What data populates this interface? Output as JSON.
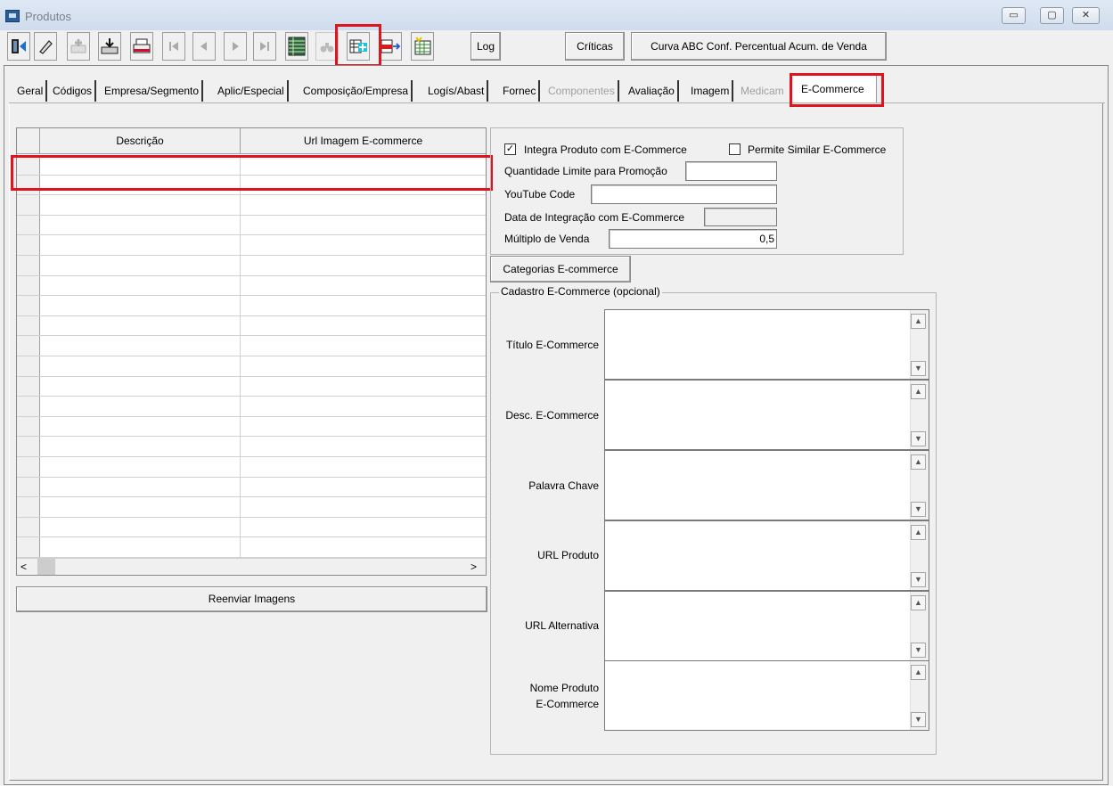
{
  "window": {
    "title": "Produtos"
  },
  "toolbar": {
    "log": "Log",
    "criticas": "Críticas",
    "curva": "Curva ABC Conf. Percentual Acum. de Venda"
  },
  "tabs": [
    {
      "label": "Geral",
      "enabled": true
    },
    {
      "label": "Códigos",
      "enabled": true
    },
    {
      "label": "Empresa/Segmento",
      "enabled": true
    },
    {
      "label": "Aplic/Especial",
      "enabled": true
    },
    {
      "label": "Composição/Empresa",
      "enabled": true
    },
    {
      "label": "Logís/Abast",
      "enabled": true
    },
    {
      "label": "Fornec",
      "enabled": true
    },
    {
      "label": "Componentes",
      "enabled": false
    },
    {
      "label": "Avaliação",
      "enabled": true
    },
    {
      "label": "Imagem",
      "enabled": true
    },
    {
      "label": "Medicam",
      "enabled": false
    },
    {
      "label": "E-Commerce",
      "enabled": true,
      "active": true
    }
  ],
  "grid": {
    "columns": [
      "Descrição",
      "Url Imagem E-commerce"
    ],
    "button": "Reenviar Imagens"
  },
  "options": {
    "integra_label": "Integra Produto com E-Commerce",
    "integra_checked": "✓",
    "similar_label": "Permite Similar E-Commerce",
    "qtd_limite_label": "Quantidade Limite para Promoção",
    "qtd_limite_value": "",
    "youtube_label": "YouTube Code",
    "youtube_value": "",
    "data_integracao_label": "Data de Integração com E-Commerce",
    "data_integracao_value": "",
    "multiplo_label": "Múltiplo de Venda",
    "multiplo_value": "0,5"
  },
  "categorias_button": "Categorias E-commerce",
  "cadastro": {
    "legend": "Cadastro E-Commerce (opcional)",
    "fields": [
      {
        "label": "Título E-Commerce"
      },
      {
        "label": "Desc. E-Commerce"
      },
      {
        "label": "Palavra Chave"
      },
      {
        "label": "URL Produto"
      },
      {
        "label": "URL Alternativa"
      },
      {
        "label": "Nome Produto\nE-Commerce"
      }
    ]
  }
}
